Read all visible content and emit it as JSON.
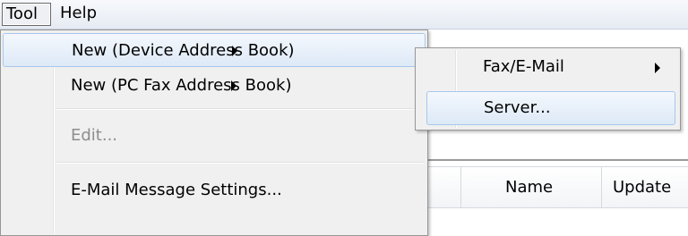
{
  "menubar": {
    "items": [
      {
        "label": "Tool"
      },
      {
        "label": "Help"
      }
    ]
  },
  "tool_menu": {
    "items": [
      {
        "label": "New (Device Address Book)",
        "has_submenu": true,
        "state": "hover"
      },
      {
        "label": "New (PC Fax Address Book)",
        "has_submenu": true,
        "state": "normal"
      },
      {
        "label": "Edit...",
        "has_submenu": false,
        "state": "disabled"
      },
      {
        "label": "E-Mail Message Settings...",
        "has_submenu": false,
        "state": "normal"
      }
    ]
  },
  "submenu": {
    "items": [
      {
        "label": "Fax/E-Mail",
        "has_submenu": true,
        "state": "normal"
      },
      {
        "label": "Server...",
        "has_submenu": false,
        "state": "hover"
      }
    ]
  },
  "table": {
    "columns": [
      {
        "label": "Name"
      },
      {
        "label": "Update"
      }
    ]
  },
  "colors": {
    "menu_background": "#f0f0f0",
    "highlight_border": "#a8c8ec",
    "disabled_text": "#8d8d8d"
  },
  "icons": {
    "submenu_arrow": "chevron-right-icon"
  }
}
